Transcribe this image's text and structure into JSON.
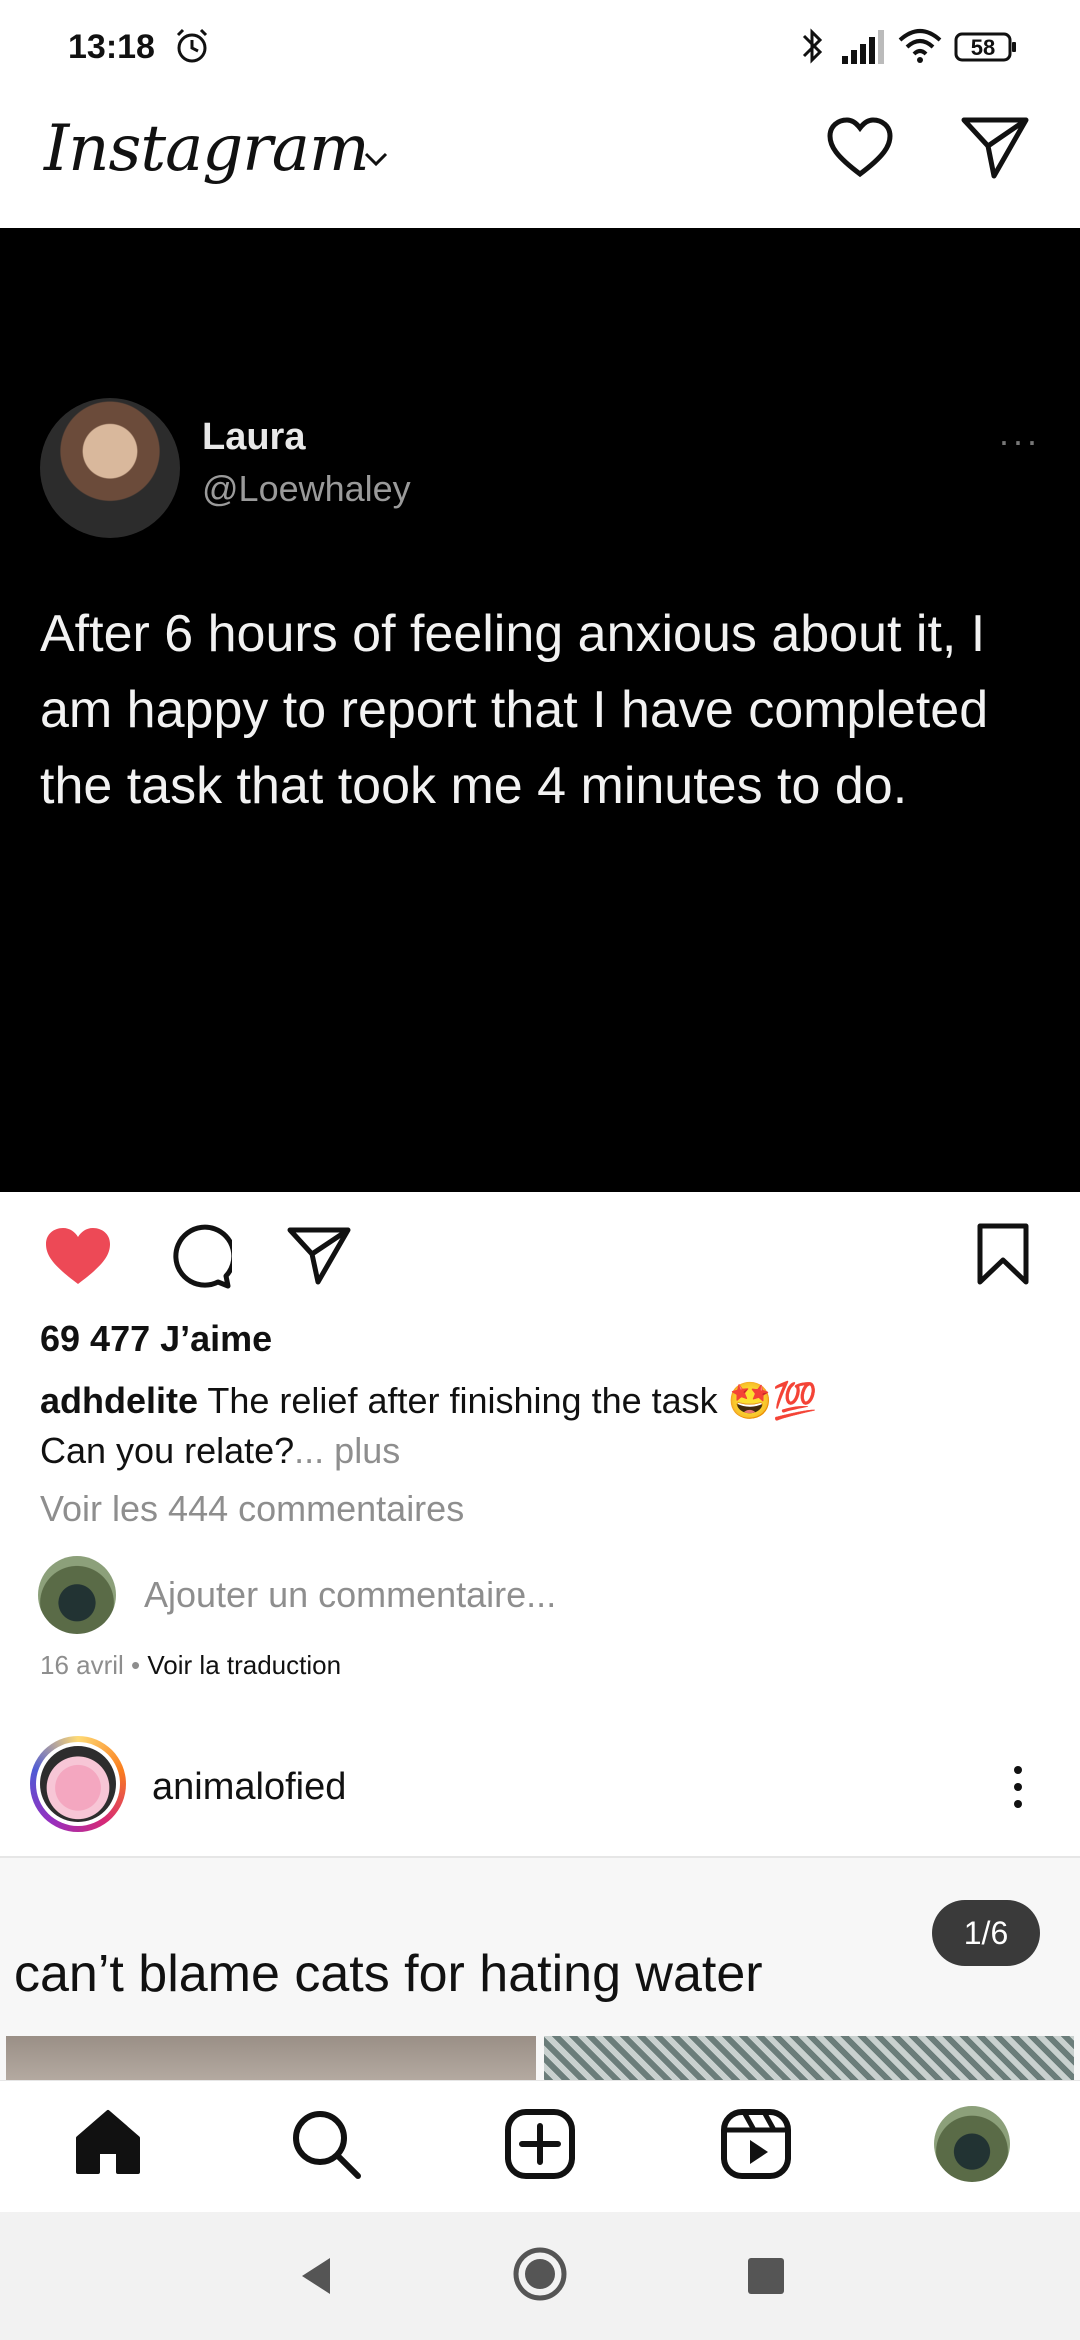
{
  "status_bar": {
    "time": "13:18",
    "battery": "58"
  },
  "header": {
    "app_title": "Instagram"
  },
  "post": {
    "tweet": {
      "name": "Laura",
      "handle": "@Loewhaley",
      "more": "···",
      "text": "After 6 hours of feeling anxious about it, I am happy to report that I have completed the task that took me 4 minutes to do."
    },
    "likes": "69 477 J’aime",
    "caption_user": "adhdelite",
    "caption_text": "The relief after finishing the task 🤩💯",
    "caption_line2": "Can you relate?",
    "caption_more": "... plus",
    "view_comments": "Voir les 444 commentaires",
    "add_comment_placeholder": "Ajouter un commentaire...",
    "date": "16 avril",
    "separator": " • ",
    "translate": "Voir la traduction"
  },
  "next_post": {
    "username": "animalofied",
    "caption_overlay": "can’t blame cats for hating water",
    "counter": "1/6"
  },
  "colors": {
    "like_red": "#ed4956",
    "muted_text": "#8e8e8e"
  },
  "icons": [
    "alarm-icon",
    "bluetooth-icon",
    "signal-icon",
    "wifi-icon",
    "battery-icon",
    "heart-icon",
    "direct-message-icon",
    "like-icon",
    "comment-icon",
    "share-icon",
    "save-icon",
    "home-icon",
    "search-icon",
    "create-icon",
    "reels-icon",
    "back-icon",
    "home-button-icon",
    "recents-icon"
  ]
}
